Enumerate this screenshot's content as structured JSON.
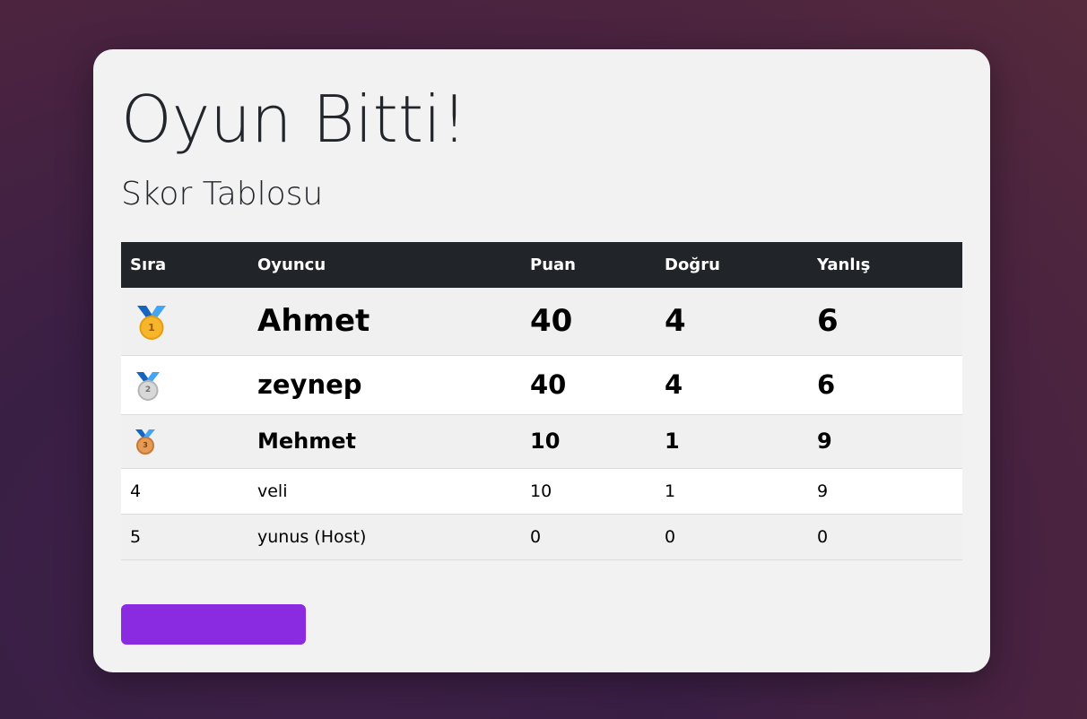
{
  "page": {
    "title": "Oyun Bitti!",
    "subtitle": "Skor Tablosu"
  },
  "table": {
    "headers": [
      "Sıra",
      "Oyuncu",
      "Puan",
      "Doğru",
      "Yanlış"
    ],
    "rows": [
      {
        "rank": "1",
        "rank_icon": "gold-medal-icon",
        "player": "Ahmet",
        "score": "40",
        "correct": "4",
        "wrong": "6"
      },
      {
        "rank": "2",
        "rank_icon": "silver-medal-icon",
        "player": "zeynep",
        "score": "40",
        "correct": "4",
        "wrong": "6"
      },
      {
        "rank": "3",
        "rank_icon": "bronze-medal-icon",
        "player": "Mehmet",
        "score": "10",
        "correct": "1",
        "wrong": "9"
      },
      {
        "rank": "4",
        "player": "veli",
        "score": "10",
        "correct": "1",
        "wrong": "9"
      },
      {
        "rank": "5",
        "player": "yunus (Host)",
        "score": "0",
        "correct": "0",
        "wrong": "0"
      }
    ]
  },
  "action_button": {
    "label": ""
  },
  "colors": {
    "background": "#3f2148",
    "card": "#f3f2f3",
    "table_header": "#212529",
    "button": "#8a2be2",
    "gold": "#f7b52c",
    "silver": "#d8d8d8",
    "bronze": "#e59a55",
    "ribbon": "#1e88e5"
  }
}
